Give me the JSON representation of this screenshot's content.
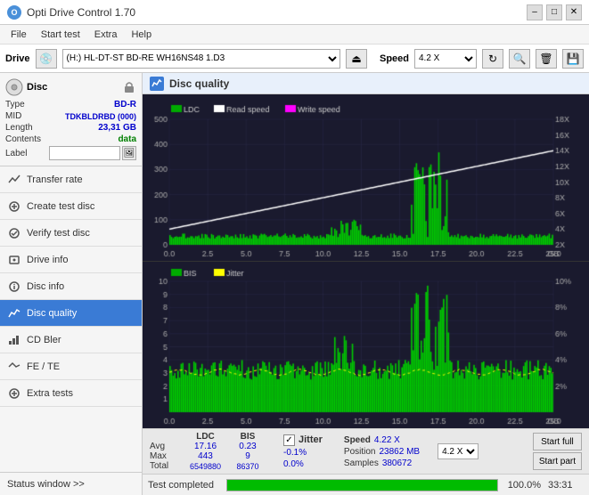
{
  "titlebar": {
    "title": "Opti Drive Control 1.70",
    "min_label": "–",
    "max_label": "□",
    "close_label": "✕"
  },
  "menubar": {
    "items": [
      "File",
      "Start test",
      "Extra",
      "Help"
    ]
  },
  "drive_section": {
    "label": "Drive",
    "drive_value": "(H:)  HL-DT-ST BD-RE  WH16NS48 1.D3",
    "speed_label": "Speed",
    "speed_value": "4.2 X"
  },
  "disc": {
    "header": "Disc",
    "type_label": "Type",
    "type_value": "BD-R",
    "mid_label": "MID",
    "mid_value": "TDKBLDRBD (000)",
    "length_label": "Length",
    "length_value": "23,31 GB",
    "contents_label": "Contents",
    "contents_value": "data",
    "label_label": "Label",
    "label_placeholder": ""
  },
  "nav": {
    "items": [
      {
        "id": "transfer-rate",
        "label": "Transfer rate",
        "active": false
      },
      {
        "id": "create-test-disc",
        "label": "Create test disc",
        "active": false
      },
      {
        "id": "verify-test-disc",
        "label": "Verify test disc",
        "active": false
      },
      {
        "id": "drive-info",
        "label": "Drive info",
        "active": false
      },
      {
        "id": "disc-info",
        "label": "Disc info",
        "active": false
      },
      {
        "id": "disc-quality",
        "label": "Disc quality",
        "active": true
      },
      {
        "id": "cd-bler",
        "label": "CD Bler",
        "active": false
      },
      {
        "id": "fe-te",
        "label": "FE / TE",
        "active": false
      },
      {
        "id": "extra-tests",
        "label": "Extra tests",
        "active": false
      }
    ]
  },
  "status_window": {
    "label": "Status window >>"
  },
  "disc_quality": {
    "title": "Disc quality",
    "legend": {
      "ldc": "LDC",
      "read_speed": "Read speed",
      "write_speed": "Write speed",
      "bis": "BIS",
      "jitter": "Jitter"
    },
    "upper_y_max": 500,
    "upper_y_right_max": 18,
    "lower_y_max": 10,
    "lower_y_right_max": 10,
    "x_max": 25.0
  },
  "stats": {
    "col_ldc": "LDC",
    "col_bis": "BIS",
    "col_jitter": "Jitter",
    "col_speed": "Speed",
    "row_avg_label": "Avg",
    "row_avg_ldc": "17.16",
    "row_avg_bis": "0.23",
    "row_avg_jitter": "-0.1%",
    "row_max_label": "Max",
    "row_max_ldc": "443",
    "row_max_bis": "9",
    "row_max_jitter": "0.0%",
    "row_total_label": "Total",
    "row_total_ldc": "6549880",
    "row_total_bis": "86370",
    "speed_value": "4.22 X",
    "position_label": "Position",
    "position_value": "23862 MB",
    "samples_label": "Samples",
    "samples_value": "380672",
    "speed_dropdown": "4.2 X",
    "start_full_label": "Start full",
    "start_part_label": "Start part",
    "jitter_checked": true,
    "jitter_label": "Jitter"
  },
  "progress": {
    "status_label": "Test completed",
    "percent": 100.0,
    "percent_label": "100.0%",
    "time_label": "33:31"
  }
}
